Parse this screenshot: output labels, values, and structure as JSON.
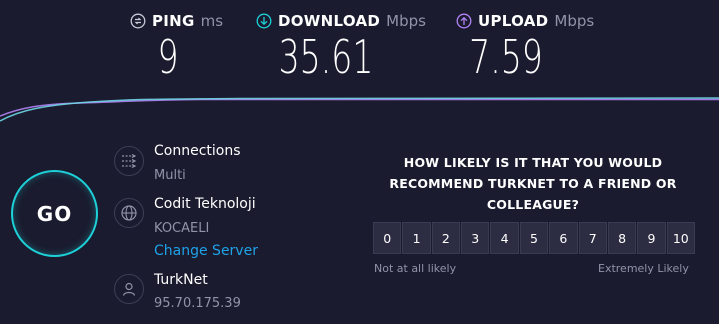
{
  "metrics": {
    "ping": {
      "label": "PING",
      "unit": "ms",
      "value": "9",
      "icon": "ping-icon",
      "color": "#9193a8"
    },
    "download": {
      "label": "DOWNLOAD",
      "unit": "Mbps",
      "value": "35.61",
      "icon": "download-icon",
      "color": "#1dd1d9"
    },
    "upload": {
      "label": "UPLOAD",
      "unit": "Mbps",
      "value": "7.59",
      "icon": "upload-icon",
      "color": "#b283f5"
    }
  },
  "go_label": "GO",
  "connections": {
    "title": "Connections",
    "value": "Multi",
    "icon": "connections-icon"
  },
  "server": {
    "title": "Codit Teknoloji",
    "location": "KOCAELI",
    "change_label": "Change Server",
    "icon": "globe-icon"
  },
  "provider": {
    "name": "TurkNet",
    "ip": "95.70.175.39",
    "icon": "user-icon"
  },
  "survey": {
    "question": "HOW LIKELY IS IT THAT YOU WOULD RECOMMEND TURKNET TO A FRIEND OR COLLEAGUE?",
    "options": [
      "0",
      "1",
      "2",
      "3",
      "4",
      "5",
      "6",
      "7",
      "8",
      "9",
      "10"
    ],
    "low_label": "Not at all likely",
    "high_label": "Extremely Likely"
  },
  "colors": {
    "background": "#1a1b2e",
    "accent": "#1dd1d9",
    "upload": "#b283f5",
    "link": "#1fa2e8"
  }
}
